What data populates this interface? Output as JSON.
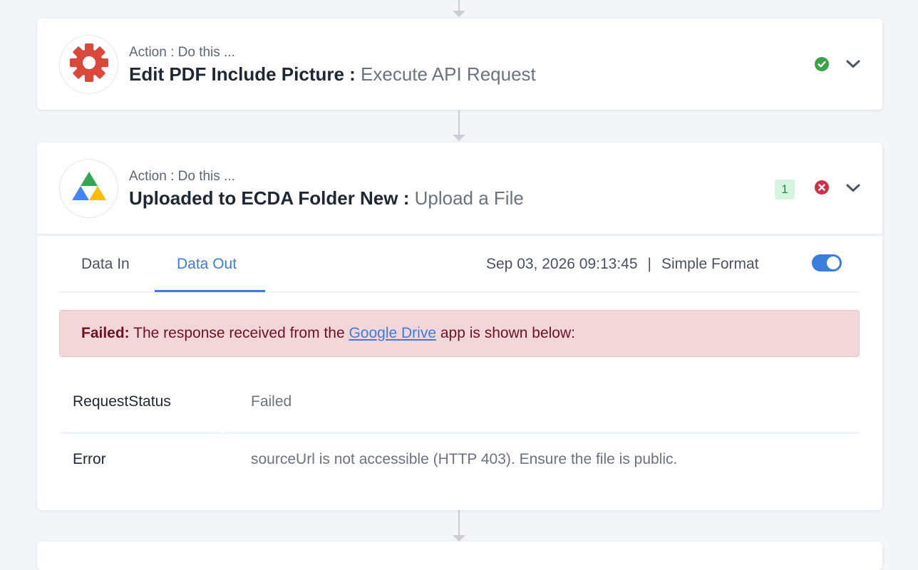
{
  "steps": [
    {
      "subtitle": "Action : Do this ...",
      "title": "Edit PDF Include Picture : ",
      "action": "Execute API Request",
      "status": "success",
      "logo_icon": "gear-icon"
    },
    {
      "subtitle": "Action : Do this ...",
      "title": "Uploaded to ECDA Folder New : ",
      "action": "Upload a File",
      "status": "error",
      "count_badge": "1",
      "logo_icon": "google-drive-icon"
    }
  ],
  "panel": {
    "tabs": [
      {
        "label": "Data In",
        "active": false
      },
      {
        "label": "Data Out",
        "active": true
      }
    ],
    "timestamp": "Sep 03, 2026 09:13:45",
    "separator": "|",
    "format_label": "Simple Format",
    "format_toggle_on": true,
    "alert": {
      "prefix": "Failed:",
      "text_before": " The response received from the ",
      "link": "Google Drive",
      "text_after": " app is shown below:"
    },
    "rows": [
      {
        "key": "RequestStatus",
        "value": "Failed"
      },
      {
        "key": "Error",
        "value": "sourceUrl is not accessible (HTTP 403). Ensure the file is public."
      }
    ]
  },
  "colors": {
    "accent": "#3b7ddd",
    "success": "#3aa34a",
    "error": "#d12f45",
    "gear": "#d9483b"
  }
}
